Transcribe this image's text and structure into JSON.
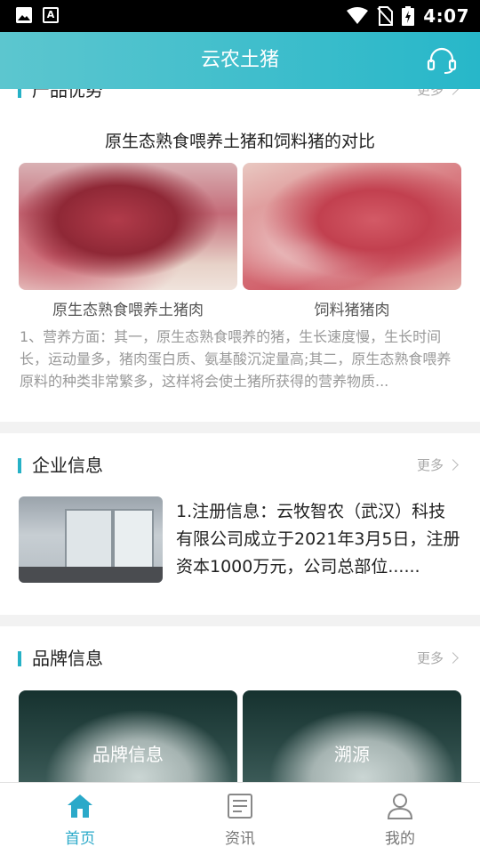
{
  "status": {
    "time": "4:07"
  },
  "app": {
    "title": "云农土猪"
  },
  "advantages": {
    "title": "产品优势",
    "more": "更多",
    "compare_title": "原生态熟食喂养土猪和饲料猪的对比",
    "left_caption": "原生态熟食喂养土猪肉",
    "right_caption": "饲料猪猪肉",
    "description": "1、营养方面：其一，原生态熟食喂养的猪，生长速度慢，生长时间长，运动量多，猪肉蛋白质、氨基酸沉淀量高;其二，原生态熟食喂养原料的种类非常繁多，这样将会使土猪所获得的营养物质..."
  },
  "enterprise": {
    "title": "企业信息",
    "more": "更多",
    "text": "1.注册信息：云牧智农（武汉）科技有限公司成立于2021年3月5日，注册资本1000万元，公司总部位......"
  },
  "brand": {
    "title": "品牌信息",
    "more": "更多",
    "cards": [
      {
        "label": "品牌信息"
      },
      {
        "label": "溯源"
      }
    ]
  },
  "tabs": [
    {
      "label": "首页",
      "active": true
    },
    {
      "label": "资讯",
      "active": false
    },
    {
      "label": "我的",
      "active": false
    }
  ],
  "colors": {
    "accent": "#26b1c6",
    "appbar_start": "#5cc6cf",
    "appbar_end": "#27b7c9",
    "tab_active": "#2aa9c9"
  }
}
